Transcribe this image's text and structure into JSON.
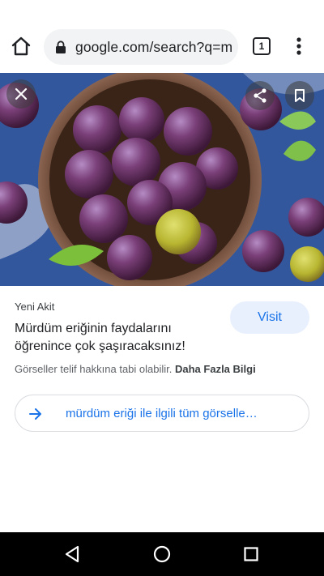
{
  "browser": {
    "url": "google.com/search?q=m",
    "tab_count": "1",
    "icons": [
      "home-icon",
      "lock-icon",
      "tabs-icon",
      "more-vert-icon"
    ]
  },
  "viewer": {
    "icons": [
      "close-icon",
      "share-icon",
      "bookmark-icon"
    ]
  },
  "result": {
    "source": "Yeni Akit",
    "title": "Mürdüm eriğinin faydalarını öğrenince çok şaşıracaksınız!",
    "visit_label": "Visit",
    "copyright_text": "Görseller telif hakkına tabi olabilir.",
    "more_info_label": "Daha Fazla Bilgi",
    "related_label": "mürdüm eriği ile ilgili tüm görselle…"
  },
  "system_nav": {
    "icons": [
      "back-icon",
      "home-circle-icon",
      "recents-icon"
    ]
  },
  "colors": {
    "accent": "#1a73e8",
    "visit_bg": "#e8f0fe",
    "url_bar_bg": "#f1f3f4",
    "nav_bar_bg": "#000000"
  }
}
